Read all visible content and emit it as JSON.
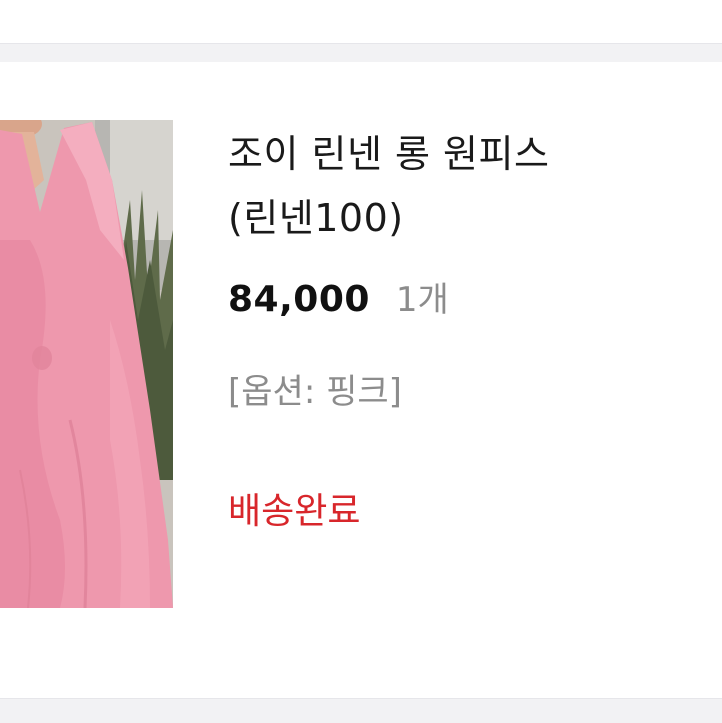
{
  "product": {
    "name_line1": "조이 린넨 롱 원피스",
    "name_line2": "(린넨100)",
    "price": "84,000",
    "quantity": "1개",
    "option": "[옵션: 핑크]",
    "status": "배송완료",
    "image_alt": "pink linen long dress photo"
  },
  "colors": {
    "status_red": "#d8262b",
    "dress_pink": "#ee98ad",
    "muted_text": "#8c8c8c",
    "background": "#f2f2f4"
  }
}
